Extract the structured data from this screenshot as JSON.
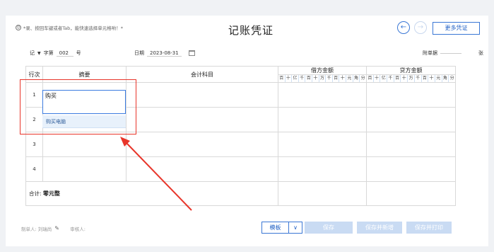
{
  "header": {
    "hint_text": "*录、按回车键或者Tab，能快速选择单元格哟！*",
    "title": "记账凭证",
    "more_button": "更多凭证"
  },
  "meta": {
    "voucher_word": "记",
    "word_label": "字第",
    "number": "002",
    "number_suffix": "号",
    "date_label": "日期",
    "date_value": "2023-08-31",
    "attachments_label": "附单据",
    "attachments_unit": "张"
  },
  "table": {
    "col_row": "行次",
    "col_summary": "摘要",
    "col_account": "会计科目",
    "col_debit": "借方金额",
    "col_credit": "贷方金额",
    "digits": [
      "百",
      "十",
      "亿",
      "千",
      "百",
      "十",
      "万",
      "千",
      "百",
      "十",
      "元",
      "角",
      "分"
    ],
    "rows": [
      "1",
      "2",
      "3",
      "4"
    ],
    "total_label": "合计:",
    "total_value": "零元整"
  },
  "editor": {
    "value": "购买",
    "suggestion": "购买电脑"
  },
  "footer": {
    "maker_label": "制单人: 刘瑞尚",
    "reviewer_label": "审核人:",
    "template_button": "模板",
    "save_button": "保存",
    "save_new_button": "保存并新增",
    "save_print_button": "保存并打印"
  }
}
